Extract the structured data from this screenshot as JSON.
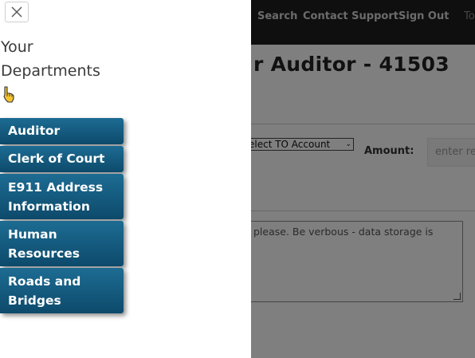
{
  "background": {
    "nav": {
      "search": "Search",
      "contact_support": "Contact Support",
      "sign_out": "Sign Out",
      "truncated": "To"
    },
    "title": "r Auditor - 41503",
    "select_value": "elect TO Account",
    "amount_label": "Amount:",
    "amount_placeholder": "enter re",
    "textarea_placeholder": "please. Be verbous - data storage is"
  },
  "panel": {
    "heading_line1": "Your",
    "heading_line2": "Departments",
    "pointer_icon": "pointing-hand-icon",
    "close_icon": "close-icon",
    "departments": [
      {
        "line1": "Auditor",
        "line2": ""
      },
      {
        "line1": "Clerk of Court",
        "line2": ""
      },
      {
        "line1": "E911 Address",
        "line2": "Information"
      },
      {
        "line1": "Human",
        "line2": "Resources"
      },
      {
        "line1": "Roads and",
        "line2": "Bridges"
      }
    ]
  },
  "colors": {
    "button_top": "#1d6c93",
    "button_bottom": "#0d4a6b",
    "overlay": "rgba(0,0,0,0.5)"
  }
}
